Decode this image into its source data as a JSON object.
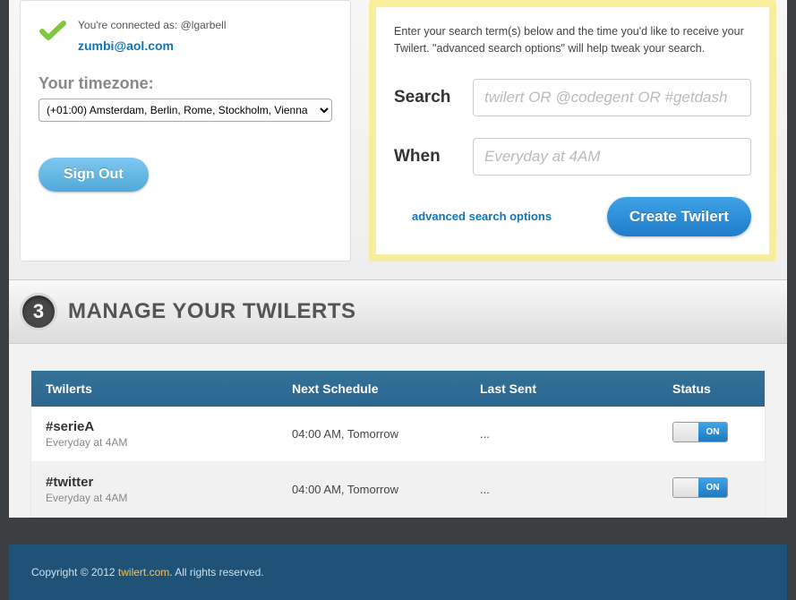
{
  "account": {
    "connected_prefix": "You're connected as: ",
    "username": "@lgarbell",
    "email": "zumbi@aol.com",
    "timezone_label": "Your timezone:",
    "timezone_value": "(+01:00) Amsterdam, Berlin, Rome, Stockholm, Vienna",
    "signout_label": "Sign Out"
  },
  "search": {
    "intro": "Enter your search term(s) below and the time you'd like to receive your Twilert. \"advanced search options\" will help tweak your search.",
    "search_label": "Search",
    "search_placeholder": "twilert OR @codegent OR #getdash",
    "when_label": "When",
    "when_placeholder": "Everyday at 4AM",
    "advanced_label": "advanced search options",
    "create_label": "Create Twilert"
  },
  "manage": {
    "step_number": "3",
    "title": "MANAGE YOUR TWILERTS",
    "headers": {
      "twilerts": "Twilerts",
      "schedule": "Next Schedule",
      "lastsent": "Last Sent",
      "status": "Status"
    },
    "rows": [
      {
        "name": "#serieA",
        "freq": "Everyday at 4AM",
        "schedule": "04:00 AM, Tomorrow",
        "lastsent": "...",
        "toggle_label": "ON"
      },
      {
        "name": "#twitter",
        "freq": "Everyday at 4AM",
        "schedule": "04:00 AM, Tomorrow",
        "lastsent": "...",
        "toggle_label": "ON"
      }
    ]
  },
  "footer": {
    "copyright_pre": "Copyright © 2012 ",
    "link_text": "twilert.com",
    "copyright_post": ". All rights reserved."
  }
}
